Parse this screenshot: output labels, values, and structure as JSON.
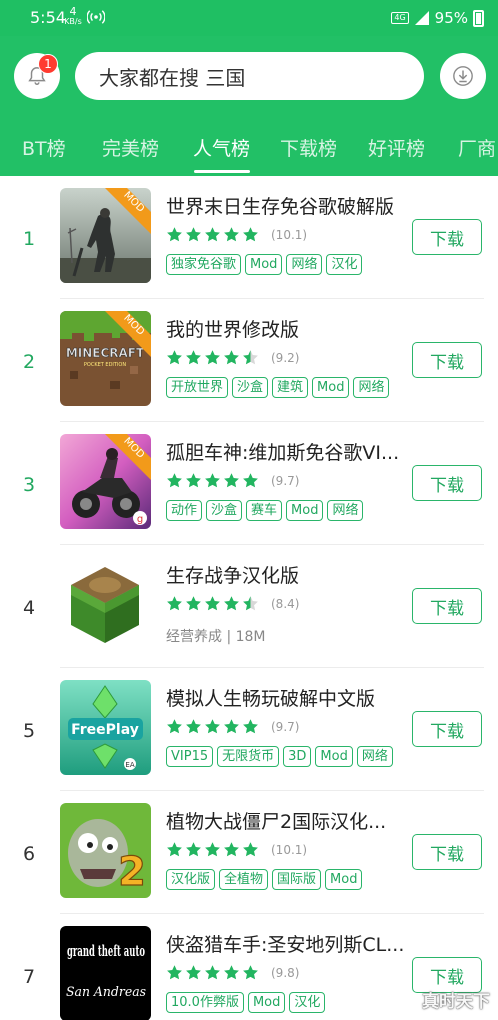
{
  "status_bar": {
    "time": "5:54",
    "net_speed": "4",
    "net_unit": "KB/s",
    "network_type": "4G",
    "battery": "95%"
  },
  "header": {
    "notification_count": "1",
    "search_placeholder": "大家都在搜  三国"
  },
  "tabs": [
    {
      "label": "BT榜"
    },
    {
      "label": "完美榜"
    },
    {
      "label": "人气榜"
    },
    {
      "label": "下载榜"
    },
    {
      "label": "好评榜"
    },
    {
      "label": "厂商"
    }
  ],
  "active_tab": 2,
  "accent_color": "#22c066",
  "apps": [
    {
      "rank": "1",
      "title": "世界末日生存免谷歌破解版",
      "rating": 5,
      "score": "(10.1)",
      "tags": [
        "独家免谷歌",
        "Mod",
        "网络",
        "汉化"
      ],
      "meta": "",
      "badge": "MOD",
      "button": "下载"
    },
    {
      "rank": "2",
      "title": "我的世界修改版",
      "rating": 4.5,
      "score": "(9.2)",
      "tags": [
        "开放世界",
        "沙盒",
        "建筑",
        "Mod",
        "网络"
      ],
      "meta": "",
      "badge": "MOD",
      "icon_text": "MINECRAFT",
      "icon_subtext": "POCKET EDITION",
      "button": "下载"
    },
    {
      "rank": "3",
      "title": "孤胆车神:维加斯免谷歌VI...",
      "rating": 5,
      "score": "(9.7)",
      "tags": [
        "动作",
        "沙盒",
        "赛车",
        "Mod",
        "网络"
      ],
      "meta": "",
      "badge": "MOD",
      "button": "下载"
    },
    {
      "rank": "4",
      "title": "生存战争汉化版",
      "rating": 4.5,
      "score": "(8.4)",
      "tags": [],
      "meta": "经营养成 | 18M",
      "badge": "",
      "button": "下载"
    },
    {
      "rank": "5",
      "title": "模拟人生畅玩破解中文版",
      "rating": 5,
      "score": "(9.7)",
      "tags": [
        "VIP15",
        "无限货币",
        "3D",
        "Mod",
        "网络"
      ],
      "meta": "",
      "badge": "",
      "icon_text": "FreePlay",
      "button": "下载"
    },
    {
      "rank": "6",
      "title": "植物大战僵尸2国际汉化...",
      "rating": 5,
      "score": "(10.1)",
      "tags": [
        "汉化版",
        "全植物",
        "国际版",
        "Mod"
      ],
      "meta": "",
      "badge": "",
      "button": "下载"
    },
    {
      "rank": "7",
      "title": "侠盗猎车手:圣安地列斯CL...",
      "rating": 5,
      "score": "(9.8)",
      "tags": [
        "10.0作弊版",
        "Mod",
        "汉化"
      ],
      "meta": "",
      "badge": "",
      "icon_text": "grand theft auto",
      "icon_subtext": "San Andreas",
      "button": "下载"
    }
  ],
  "watermark": "真时天下"
}
